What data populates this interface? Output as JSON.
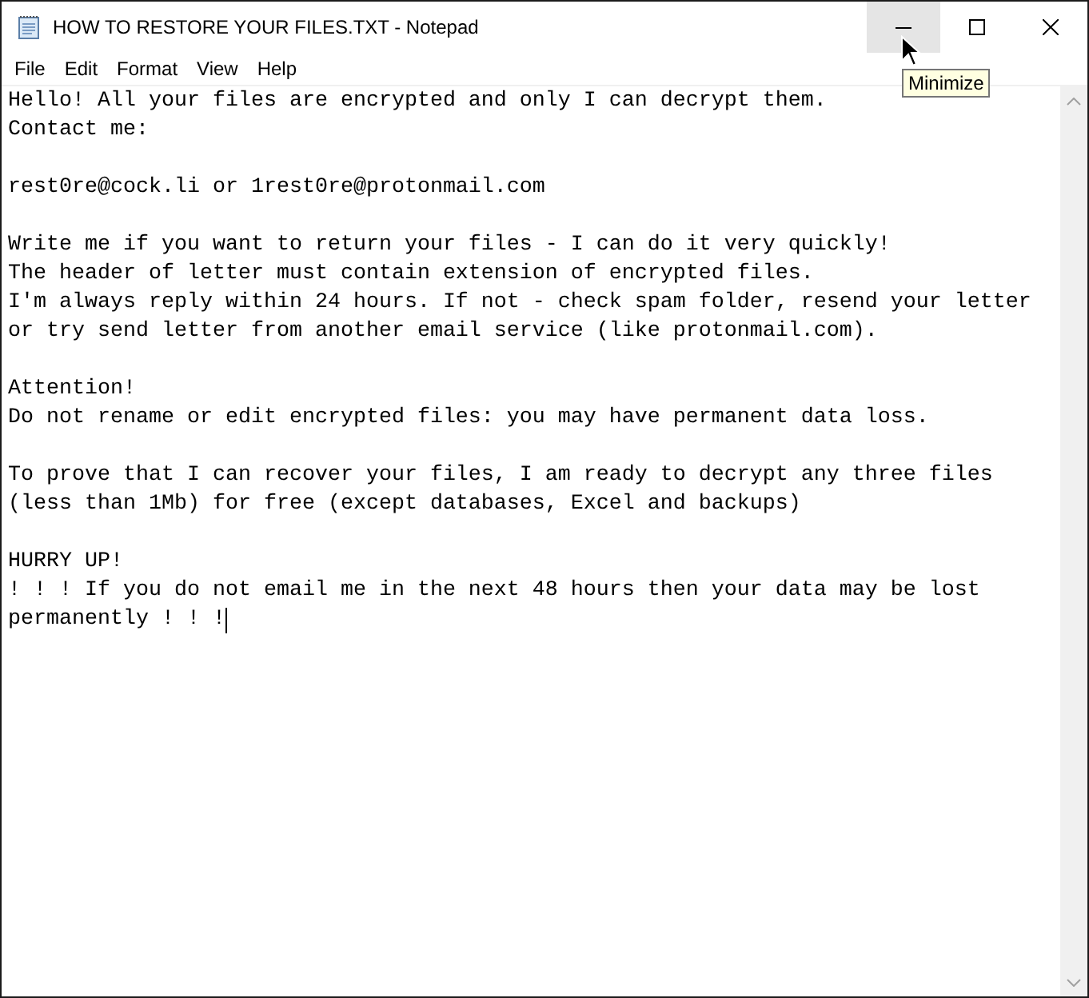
{
  "window": {
    "title": "HOW TO RESTORE YOUR FILES.TXT - Notepad",
    "controls": [
      {
        "kind": "minimize",
        "hovered": true
      },
      {
        "kind": "maximize",
        "hovered": false
      },
      {
        "kind": "close",
        "hovered": false
      }
    ],
    "tooltip": "Minimize"
  },
  "menu": [
    "File",
    "Edit",
    "Format",
    "View",
    "Help"
  ],
  "document": {
    "paragraphs": [
      [
        "Hello! All your files are encrypted and only I can decrypt them.",
        "Contact me:"
      ],
      [
        "rest0re@cock.li or 1rest0re@protonmail.com"
      ],
      [
        "Write me if you want to return your files - I can do it very quickly!",
        "The header of letter must contain extension of encrypted files.",
        "I'm always reply within 24 hours. If not - check spam folder, resend your letter",
        "or try send letter from another email service (like protonmail.com)."
      ],
      [
        "Attention!",
        "Do not rename or edit encrypted files: you may have permanent data loss."
      ],
      [
        "To prove that I can recover your files, I am ready to decrypt any three files",
        "(less than 1Mb) for free (except databases, Excel and backups)"
      ],
      [
        "HURRY UP!",
        "! ! ! If you do not email me in the next 48 hours then your data may be lost",
        "permanently ! ! !"
      ]
    ]
  }
}
